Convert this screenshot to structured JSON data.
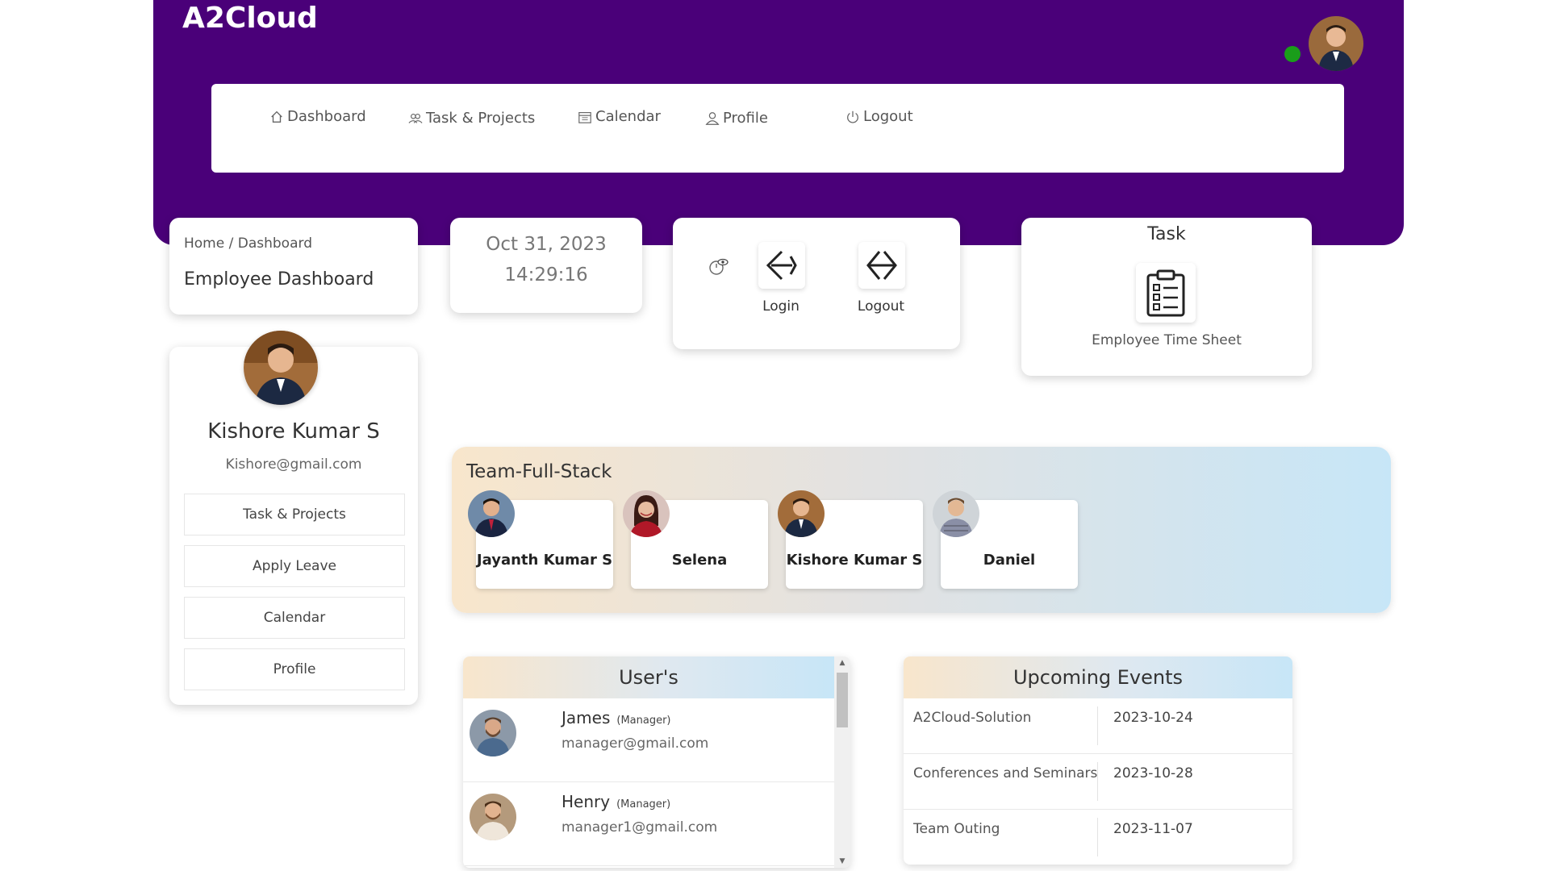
{
  "app": {
    "title": "A2Cloud"
  },
  "nav": {
    "items": [
      {
        "label": "Dashboard",
        "icon": "home-icon"
      },
      {
        "label": "Task & Projects",
        "icon": "users-icon"
      },
      {
        "label": "Calendar",
        "icon": "calendar-icon"
      },
      {
        "label": "Profile",
        "icon": "user-icon"
      },
      {
        "label": "Logout",
        "icon": "power-icon"
      }
    ]
  },
  "breadcrumb": {
    "home": "Home",
    "separator": " / ",
    "current": "Dashboard"
  },
  "page": {
    "title": "Employee Dashboard"
  },
  "clock": {
    "date": "Oct 31, 2023",
    "time": "14:29:16"
  },
  "attendance": {
    "login_label": "Login",
    "logout_label": "Logout"
  },
  "task": {
    "title": "Task",
    "item_label": "Employee Time Sheet"
  },
  "profile": {
    "name": "Kishore Kumar S",
    "email": "Kishore@gmail.com",
    "buttons": [
      "Task & Projects",
      "Apply Leave",
      "Calendar",
      "Profile"
    ]
  },
  "team": {
    "title": "Team-Full-Stack",
    "members": [
      {
        "name": "Jayanth Kumar S"
      },
      {
        "name": "Selena"
      },
      {
        "name": "Kishore Kumar S"
      },
      {
        "name": "Daniel"
      }
    ]
  },
  "users": {
    "title": "User's",
    "list": [
      {
        "name": "James",
        "role": "(Manager)",
        "email": "manager@gmail.com"
      },
      {
        "name": "Henry",
        "role": "(Manager)",
        "email": "manager1@gmail.com"
      }
    ]
  },
  "events": {
    "title": "Upcoming Events",
    "list": [
      {
        "name": "A2Cloud-Solution",
        "date": "2023-10-24"
      },
      {
        "name": "Conferences and Seminars",
        "date": "2023-10-28"
      },
      {
        "name": "Team Outing",
        "date": "2023-11-07"
      }
    ]
  },
  "colors": {
    "header": "#4a0079",
    "status_online": "#1a9d1a"
  }
}
